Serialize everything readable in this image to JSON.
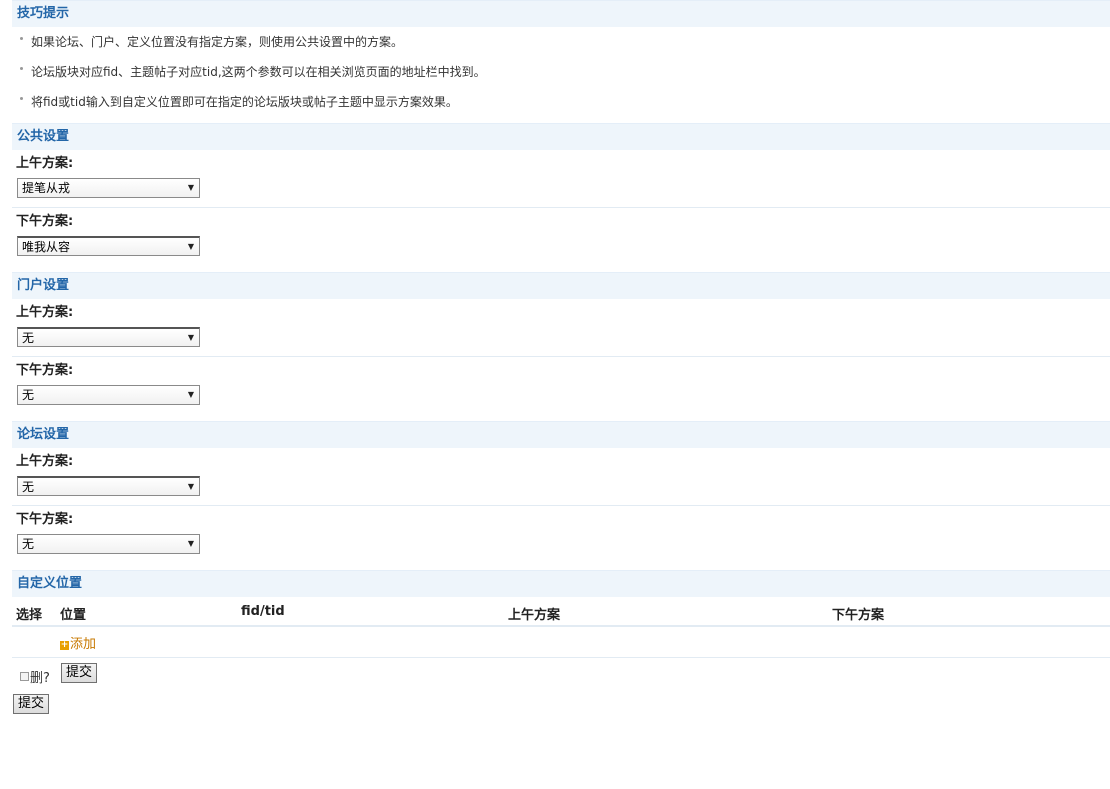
{
  "tips": {
    "title": "技巧提示",
    "items": [
      "如果论坛、门户、定义位置没有指定方案，则使用公共设置中的方案。",
      "论坛版块对应fid、主题帖子对应tid,这两个参数可以在相关浏览页面的地址栏中找到。",
      "将fid或tid输入到自定义位置即可在指定的论坛版块或帖子主题中显示方案效果。"
    ]
  },
  "public": {
    "title": "公共设置",
    "am_label": "上午方案:",
    "am_value": "提笔从戎",
    "pm_label": "下午方案:",
    "pm_value": "唯我从容"
  },
  "portal": {
    "title": "门户设置",
    "am_label": "上午方案:",
    "am_value": "无",
    "pm_label": "下午方案:",
    "pm_value": "无"
  },
  "forum": {
    "title": "论坛设置",
    "am_label": "上午方案:",
    "am_value": "无",
    "pm_label": "下午方案:",
    "pm_value": "无"
  },
  "custom": {
    "title": "自定义位置",
    "columns": [
      "选择",
      "位置",
      "fid/tid",
      "上午方案",
      "下午方案"
    ],
    "add_label": "添加",
    "delete_label": "删?",
    "submit_label": "提交"
  },
  "form": {
    "submit_label": "提交"
  },
  "colors": {
    "section_header_bg": "#eef5fb",
    "section_header_text": "#2366a8",
    "add_link": "#c77800"
  }
}
